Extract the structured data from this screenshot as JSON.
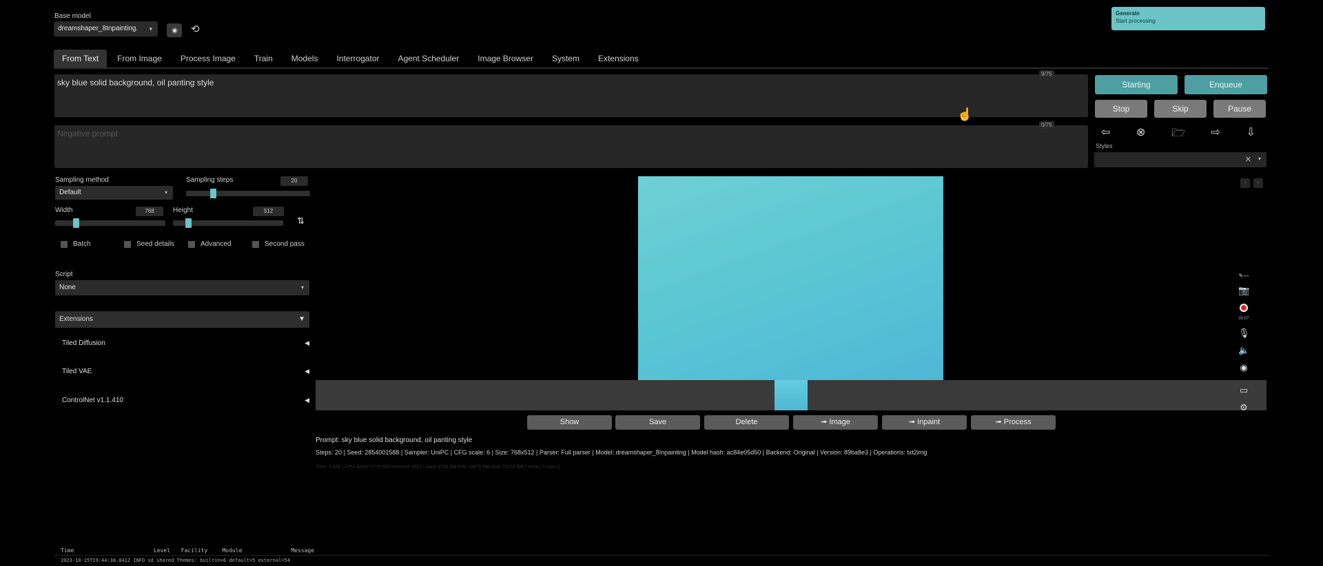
{
  "base_model": {
    "label": "Base model",
    "value": "dreamshaper_8Inpainting."
  },
  "generate_box": {
    "title": "Generate",
    "subtitle": "Start processing"
  },
  "tabs": [
    "From Text",
    "From Image",
    "Process Image",
    "Train",
    "Models",
    "Interrogator",
    "Agent Scheduler",
    "Image Browser",
    "System",
    "Extensions"
  ],
  "prompt": {
    "text": "sky blue solid background, oil panting style",
    "count": "9/75"
  },
  "negative_prompt": {
    "placeholder": "Negative prompt",
    "count": "0/75"
  },
  "actions": {
    "starting": "Starting",
    "enqueue": "Enqueue",
    "stop": "Stop",
    "skip": "Skip",
    "pause": "Pause"
  },
  "styles": {
    "label": "Styles"
  },
  "params": {
    "sampling_method_label": "Sampling method",
    "sampling_method": "Default",
    "sampling_steps_label": "Sampling steps",
    "sampling_steps": "20",
    "width_label": "Width",
    "width": "768",
    "height_label": "Height",
    "height": "512",
    "checks": [
      "Batch",
      "Seed details",
      "Advanced",
      "Second pass"
    ],
    "script_label": "Script",
    "script": "None"
  },
  "extensions": {
    "header": "Extensions",
    "items": [
      "Tiled Diffusion",
      "Tiled VAE",
      "ControlNet v1.1.410"
    ]
  },
  "gallery_buttons": [
    "Show",
    "Save",
    "Delete",
    "➟ Image",
    "➟ Inpaint",
    "➟ Process"
  ],
  "info": {
    "prompt_line": "Prompt: sky blue solid background, oil panting style",
    "params_line": "Steps: 20 | Seed: 2854001588 | Sampler: UniPC | CFG scale: 6 | Size: 768x512 | Parser: Full parser | Model: dreamshaper_8Inpainting | Model hash: ac84e05d50 | Backend: Original | Version: 89ba8e3 | Operations: txt2img",
    "timing_line": "Time: 9.69s | GPU active 3778 MB reserved 3022 | used 3784 MB free 19876 MB total 23470 MB | retries 0 oom 0"
  },
  "record_time": "00:07",
  "log": {
    "headers": [
      "Time",
      "Level",
      "Facility",
      "Module",
      "Message"
    ],
    "row": "2023-10-15T19:44:38.8412  INFO  sd  shared  Themes: builtin=6 default=5 external=54"
  },
  "colors": {
    "accent": "#6cc3c6",
    "teal_button": "#4e9ea2",
    "background": "#000000"
  }
}
